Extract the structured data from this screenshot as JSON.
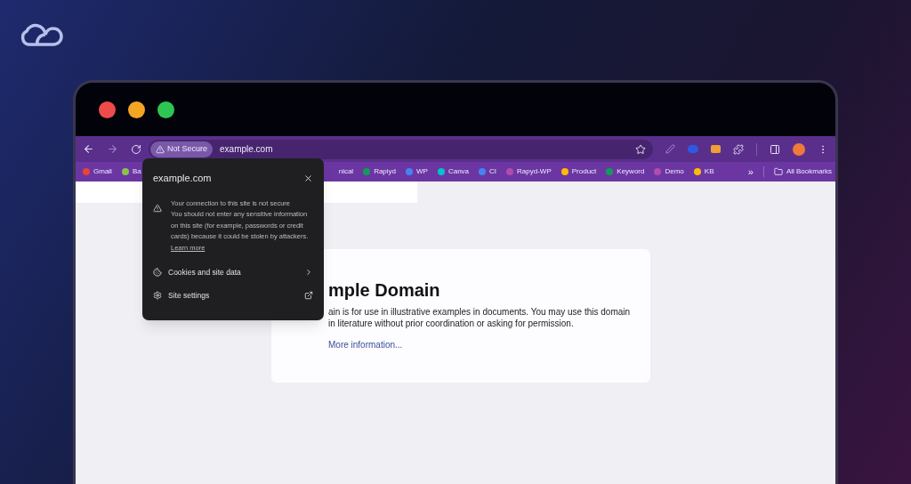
{
  "toolbar": {
    "security_chip": "Not Secure",
    "url": "example.com"
  },
  "bookmarks": [
    {
      "label": "Gmail",
      "color": "#ea4335"
    },
    {
      "label": "Ba",
      "color": "#8bc34a"
    },
    {
      "label": "nical"
    },
    {
      "label": "Rapiyd",
      "color": "#0f9d58"
    },
    {
      "label": "WP",
      "color": "#4285f4"
    },
    {
      "label": "Canva",
      "color": "#00c4cc"
    },
    {
      "label": "CI",
      "color": "#4285f4"
    },
    {
      "label": "Rapyd-WP",
      "color": "#b04cb0"
    },
    {
      "label": "Product",
      "color": "#fbbc04"
    },
    {
      "label": "Keyword",
      "color": "#0f9d58"
    },
    {
      "label": "Demo",
      "color": "#b04cb0"
    },
    {
      "label": "KB",
      "color": "#fbbc04"
    }
  ],
  "bookmarks_overflow": "»",
  "all_bookmarks": "All Bookmarks",
  "popup": {
    "title": "example.com",
    "warning_title": "Your connection to this site is not secure",
    "warning_body": "You should not enter any sensitive information on this site (for example, passwords or credit cards) because it could be stolen by attackers.",
    "learn_more": "Learn more",
    "items": [
      {
        "label": "Cookies and site data",
        "kind": "submenu"
      },
      {
        "label": "Site settings",
        "kind": "external"
      }
    ]
  },
  "page": {
    "heading": "mple Domain",
    "paragraph": "ain is for use in illustrative examples in documents. You may use this domain in literature without prior coordination or asking for permission.",
    "link": "More information..."
  }
}
